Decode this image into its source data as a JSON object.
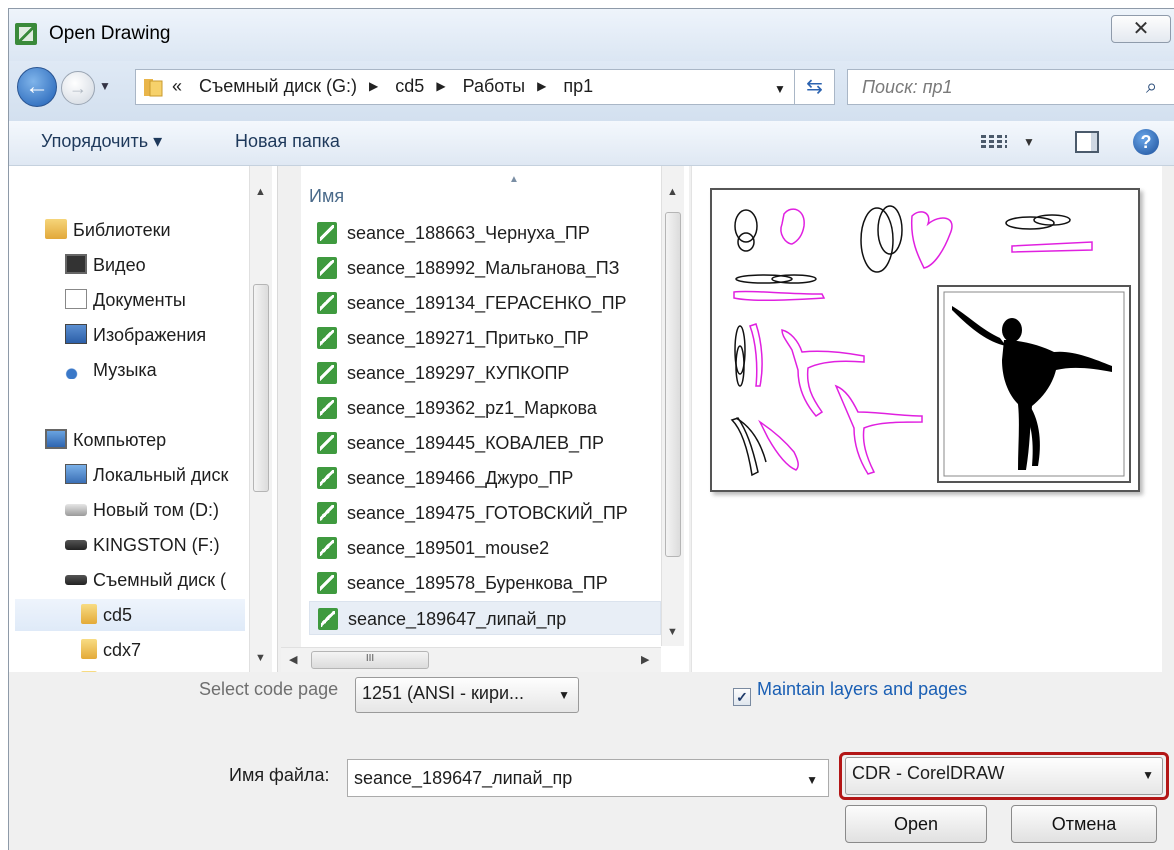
{
  "window": {
    "title": "Open Drawing",
    "close_glyph": "✕"
  },
  "address": {
    "overflow": "«",
    "crumbs": [
      "Съемный диск (G:)",
      "cd5",
      "Работы",
      "пр1"
    ],
    "search_placeholder": "Поиск: пр1"
  },
  "toolbar": {
    "organize": "Упорядочить ▾",
    "new_folder": "Новая папка"
  },
  "nav": {
    "items": [
      {
        "label": "Библиотеки",
        "icon": "library-icon"
      },
      {
        "label": "Видео",
        "icon": "video-icon"
      },
      {
        "label": "Документы",
        "icon": "documents-icon"
      },
      {
        "label": "Изображения",
        "icon": "images-icon"
      },
      {
        "label": "Музыка",
        "icon": "music-icon"
      },
      {
        "label": "Компьютер",
        "icon": "computer-icon"
      },
      {
        "label": "Локальный диск",
        "icon": "local-disk-icon"
      },
      {
        "label": "Новый том (D:)",
        "icon": "drive-icon"
      },
      {
        "label": "KINGSTON (F:)",
        "icon": "usb-drive-icon"
      },
      {
        "label": "Съемный диск (",
        "icon": "usb-drive-icon"
      },
      {
        "label": "cd5",
        "icon": "folder-icon"
      },
      {
        "label": "cdx7",
        "icon": "folder-icon"
      }
    ]
  },
  "files": {
    "column_name": "Имя",
    "items": [
      "seance_188663_Чернуха_ПР",
      "seance_188992_Мальганова_ПЗ",
      "seance_189134_ГЕРАСЕНКО_ПР",
      "seance_189271_Притько_ПР",
      "seance_189297_КУПКОПР",
      "seance_189362_pz1_Маркова",
      "seance_189445_КОВАЛЕВ_ПР",
      "seance_189466_Джуро_ПР",
      "seance_189475_ГОТОВСКИЙ_ПР",
      "seance_189501_mouse2",
      "seance_189578_Буренкова_ПР",
      "seance_189647_липай_пр"
    ],
    "selected_index": 11
  },
  "options": {
    "code_page_label": "Select code page",
    "code_page_value": "1251  (ANSI - кири...",
    "maintain_label": "Maintain layers and pages",
    "maintain_checked": true
  },
  "footer": {
    "filename_label": "Имя файла:",
    "filename_value": "seance_189647_липай_пр",
    "filetype_value": "CDR - CorelDRAW",
    "open_label": "Open",
    "cancel_label": "Отмена"
  },
  "colors": {
    "highlight_border": "#b31616",
    "magenta_shapes": "#e020e0"
  }
}
